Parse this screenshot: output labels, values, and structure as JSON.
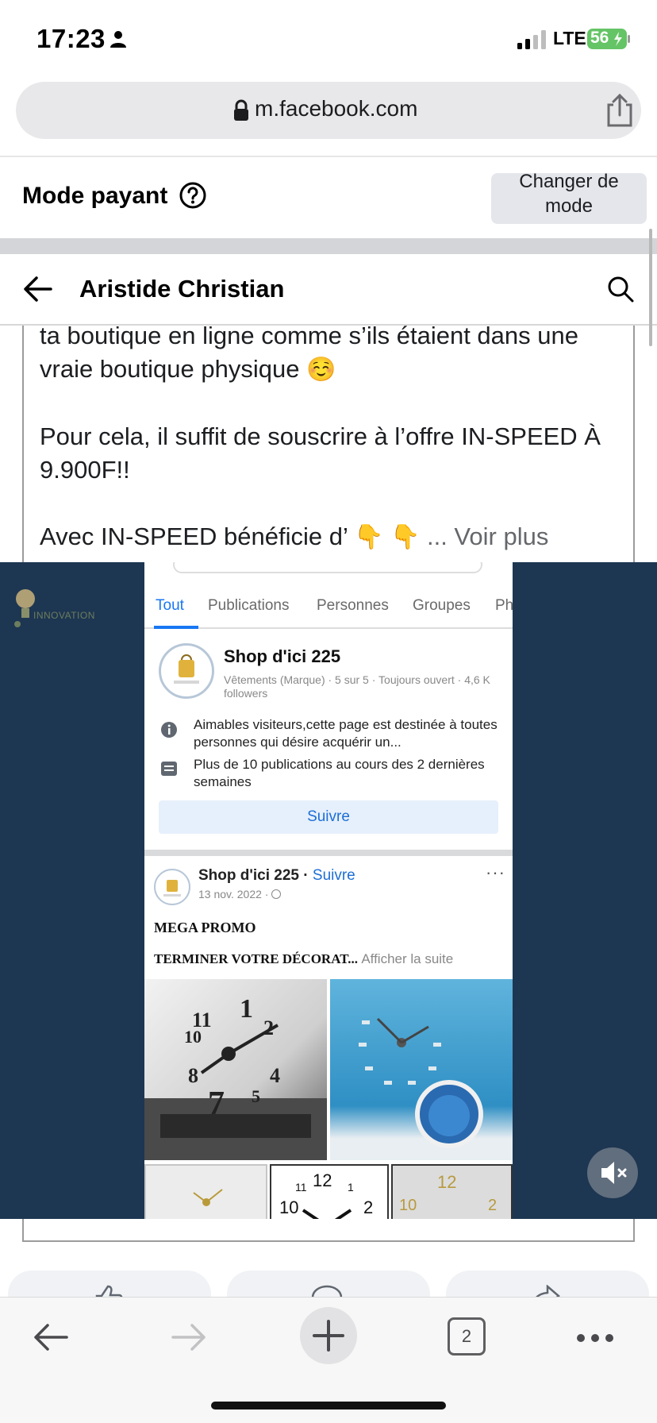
{
  "status_bar": {
    "time": "17:23",
    "network": "LTE",
    "battery": "56",
    "icons": [
      "person-icon",
      "signal-icon",
      "battery-icon"
    ]
  },
  "browser": {
    "url": "m.facebook.com",
    "icons": [
      "lock-icon",
      "share-icon"
    ]
  },
  "mode_banner": {
    "title": "Mode payant",
    "change_line1": "Changer de",
    "change_line2": "mode"
  },
  "header": {
    "profile_name": "Aristide Christian",
    "icons": [
      "back-arrow-icon",
      "search-icon"
    ]
  },
  "post": {
    "line1": "ta boutique en ligne comme s’ils étaient dans une",
    "line2": "vraie boutique physique",
    "emoji_smile": "☺️",
    "line3": "Pour cela, il suffit de souscrire à l’offre IN-SPEED À",
    "line4": "9.900F!!",
    "line5": "Avec IN-SPEED bénéficie d’",
    "emoji_point": "👇 👇",
    "see_more": "... Voir plus"
  },
  "video": {
    "logo_text": "INNOVATION",
    "search_tabs": [
      "Tout",
      "Publications",
      "Personnes",
      "Groupes",
      "Ph"
    ],
    "page_result": {
      "name": "Shop d'ici 225",
      "meta": "Vêtements (Marque) · 5 sur 5 · Toujours ouvert · 4,6 K followers",
      "info": "Aimables visiteurs,cette page est destinée à toutes personnes qui désire acquérir un...",
      "posts_info": "Plus de 10 publications au cours des 2 dernières semaines",
      "follow_label": "Suivre"
    },
    "post": {
      "name": "Shop d'ici 225",
      "follow": "Suivre",
      "date": "13 nov. 2022 ·",
      "more": "···",
      "line1": "MEGA PROMO",
      "line2": "TERMINER VOTRE DÉCORAT...",
      "afficher": "Afficher la suite"
    },
    "mute_icon": "speaker-muted-icon"
  },
  "actions": {
    "icons": [
      "like-icon",
      "comment-icon",
      "share-arrow-icon"
    ]
  },
  "toolbar": {
    "tab_count": "2",
    "icons": [
      "back-icon",
      "forward-icon",
      "plus-icon",
      "tabs-icon",
      "more-icon"
    ]
  }
}
